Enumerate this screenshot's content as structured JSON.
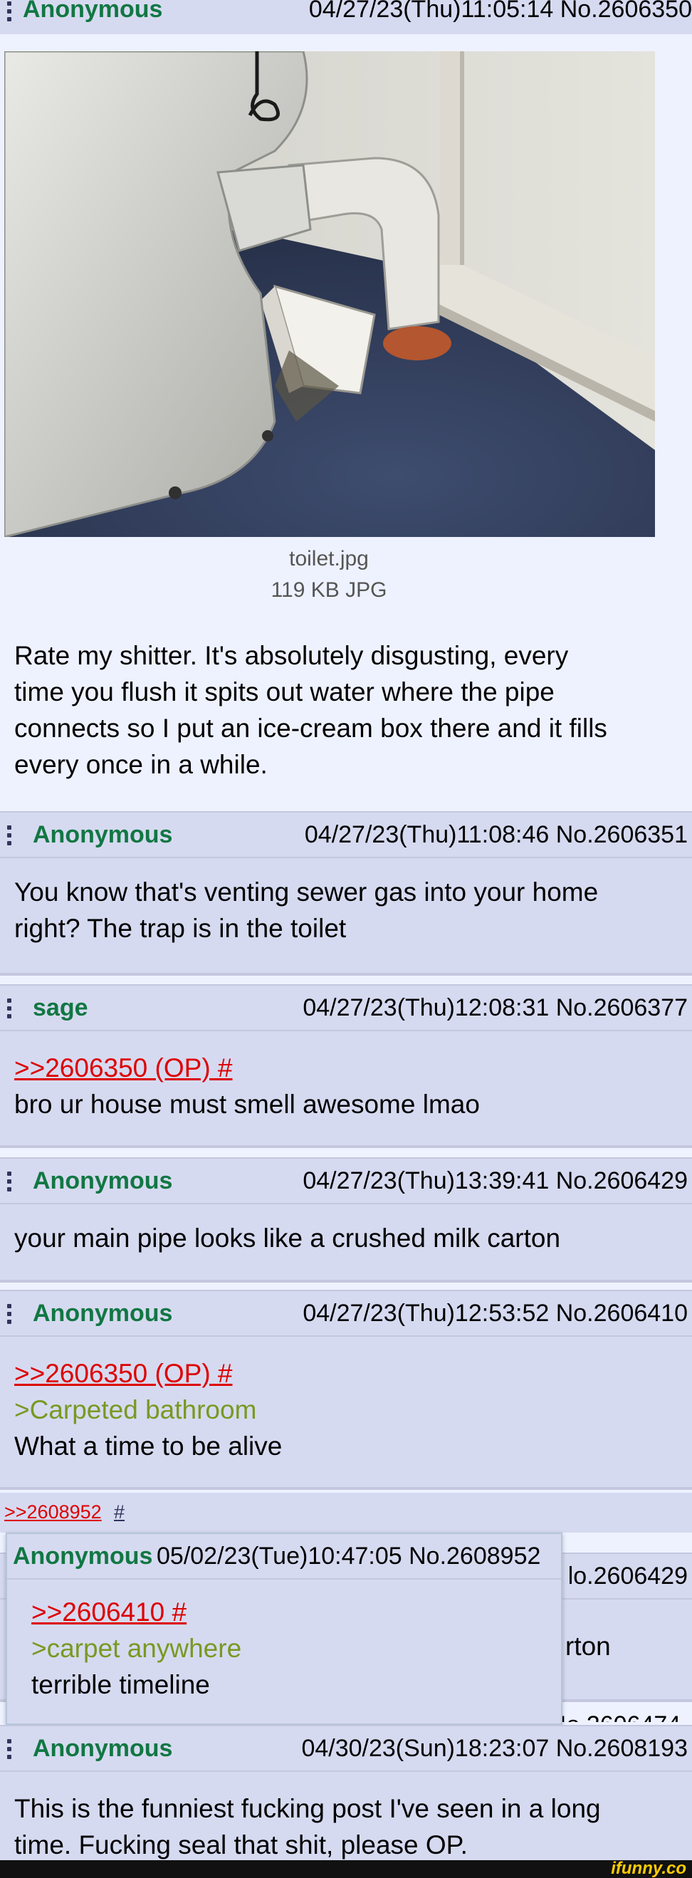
{
  "op": {
    "name": "Anonymous",
    "meta": "04/27/23(Thu)11:05:14 No.2606350",
    "file_name": "toilet.jpg",
    "file_info": "119 KB JPG",
    "comment": "Rate my shitter. It's absolutely disgusting, every time you flush it spits out water where the pipe connects so I put an ice-cream box there and it fills every once in a while.",
    "comment_lines": [
      "Rate my shitter. It's absolutely disgusting, every",
      "time you flush it spits out water where the pipe",
      "connects so I put an ice-cream box there and it fills",
      "every once in a while."
    ]
  },
  "replies": [
    {
      "name": "Anonymous",
      "meta": "04/27/23(Thu)11:08:46 No.2606351",
      "lines": [
        "You know that's venting sewer gas into your home",
        "right? The trap is in the toilet"
      ]
    },
    {
      "name": "sage",
      "meta": "04/27/23(Thu)12:08:31 No.2606377",
      "quote": ">>2606350 (OP) #",
      "lines": [
        "bro ur house must smell awesome lmao"
      ]
    },
    {
      "name": "Anonymous",
      "meta": "04/27/23(Thu)13:39:41 No.2606429",
      "lines": [
        "your main pipe looks like a crushed milk carton"
      ]
    },
    {
      "name": "Anonymous",
      "meta": "04/27/23(Thu)12:53:52 No.2606410",
      "quote": ">>2606350 (OP) #",
      "greentext": ">Carpeted bathroom",
      "lines": [
        "What a time to be alive"
      ]
    }
  ],
  "backlink": {
    "link": ">>2608952",
    "hash": "#"
  },
  "hidden_post": {
    "meta_partial": "lo.2606429",
    "text_partial": "rton",
    "meta_partial_2": "Io 2606474"
  },
  "popup": {
    "name": "Anonymous",
    "meta": "05/02/23(Tue)10:47:05 No.2608952",
    "quote": ">>2606410 #",
    "greentext": ">carpet anywhere",
    "line": "terrible timeline"
  },
  "last": {
    "name": "Anonymous",
    "meta": "04/30/23(Sun)18:23:07 No.2608193",
    "lines": [
      "This is the funniest fucking post I've seen in a long",
      "time. Fucking seal that shit, please OP."
    ]
  },
  "watermark": "ifunny.co",
  "colors": {
    "name_green": "#117743",
    "quote_red": "#dd0000",
    "greentext": "#789922",
    "post_bg": "#d6daf0",
    "page_bg": "#eef2ff"
  }
}
